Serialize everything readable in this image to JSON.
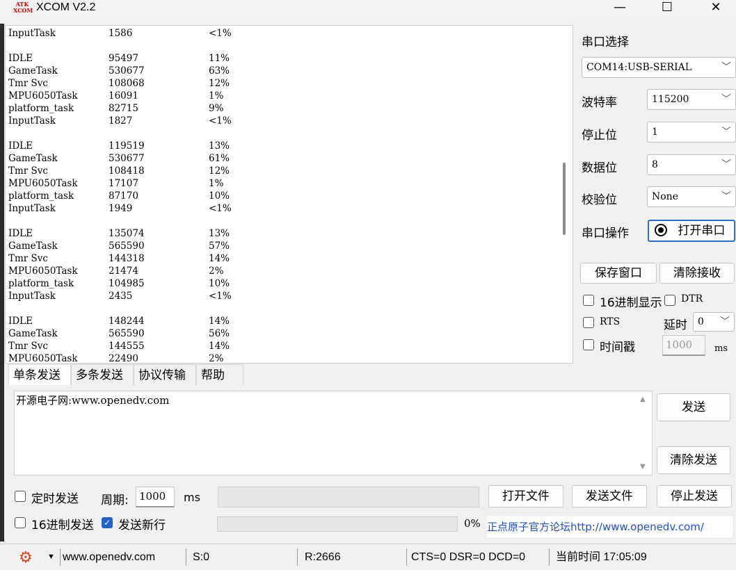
{
  "window": {
    "title": "XCOM V2.2",
    "icon_text_top": "ATK",
    "icon_text_bottom": "XCOM",
    "minimize": "—",
    "maximize": "☐",
    "close": "✕"
  },
  "receive": {
    "lines": [
      [
        "InputTask",
        "1586",
        "<1%"
      ],
      [
        "",
        "",
        ""
      ],
      [
        "IDLE",
        "95497",
        "11%"
      ],
      [
        "GameTask",
        "530677",
        "63%"
      ],
      [
        "Tmr Svc",
        "108068",
        "12%"
      ],
      [
        "MPU6050Task",
        "16091",
        "1%"
      ],
      [
        "platform_task",
        "82715",
        "9%"
      ],
      [
        "InputTask",
        "1827",
        "<1%"
      ],
      [
        "",
        "",
        ""
      ],
      [
        "IDLE",
        "119519",
        "13%"
      ],
      [
        "GameTask",
        "530677",
        "61%"
      ],
      [
        "Tmr Svc",
        "108418",
        "12%"
      ],
      [
        "MPU6050Task",
        "17107",
        "1%"
      ],
      [
        "platform_task",
        "87170",
        "10%"
      ],
      [
        "InputTask",
        "1949",
        "<1%"
      ],
      [
        "",
        "",
        ""
      ],
      [
        "IDLE",
        "135074",
        "13%"
      ],
      [
        "GameTask",
        "565590",
        "57%"
      ],
      [
        "Tmr Svc",
        "144318",
        "14%"
      ],
      [
        "MPU6050Task",
        "21474",
        "2%"
      ],
      [
        "platform_task",
        "104985",
        "10%"
      ],
      [
        "InputTask",
        "2435",
        "<1%"
      ],
      [
        "",
        "",
        ""
      ],
      [
        "IDLE",
        "148244",
        "14%"
      ],
      [
        "GameTask",
        "565590",
        "56%"
      ],
      [
        "Tmr Svc",
        "144555",
        "14%"
      ],
      [
        "MPU6050Task",
        "22490",
        "2%"
      ]
    ]
  },
  "settings": {
    "port_label": "串口选择",
    "port_value": "COM14:USB-SERIAL",
    "baud_label": "波特率",
    "baud_value": "115200",
    "stop_label": "停止位",
    "stop_value": "1",
    "data_label": "数据位",
    "data_value": "8",
    "parity_label": "校验位",
    "parity_value": "None",
    "op_label": "串口操作",
    "open_port_button": "打开串口",
    "save_window_button": "保存窗口",
    "clear_recv_button": "清除接收",
    "hex_display_label": "16进制显示",
    "dtr_label": "DTR",
    "rts_label": "RTS",
    "delay_label": "延时",
    "delay_value": "0",
    "timestamp_label": "时间戳",
    "timestamp_value": "1000",
    "timestamp_unit": "ms"
  },
  "tabs": [
    "单条发送",
    "多条发送",
    "协议传输",
    "帮助"
  ],
  "send": {
    "text": "开源电子网:www.openedv.com",
    "send_button": "发送",
    "clear_send_button": "清除发送",
    "timed_send_label": "定时发送",
    "period_label": "周期:",
    "period_value": "1000",
    "period_unit": "ms",
    "open_file_button": "打开文件",
    "send_file_button": "发送文件",
    "stop_send_button": "停止发送",
    "hex_send_label": "16进制发送",
    "newline_label": "发送新行",
    "progress_text": "0%",
    "progress": 0,
    "forum_link": "正点原子官方论坛http://www.openedv.com/"
  },
  "status": {
    "website": "www.openedv.com",
    "sent": "S:0",
    "received": "R:2666",
    "lines": "CTS=0 DSR=0 DCD=0",
    "time": "当前时间 17:05:09"
  }
}
